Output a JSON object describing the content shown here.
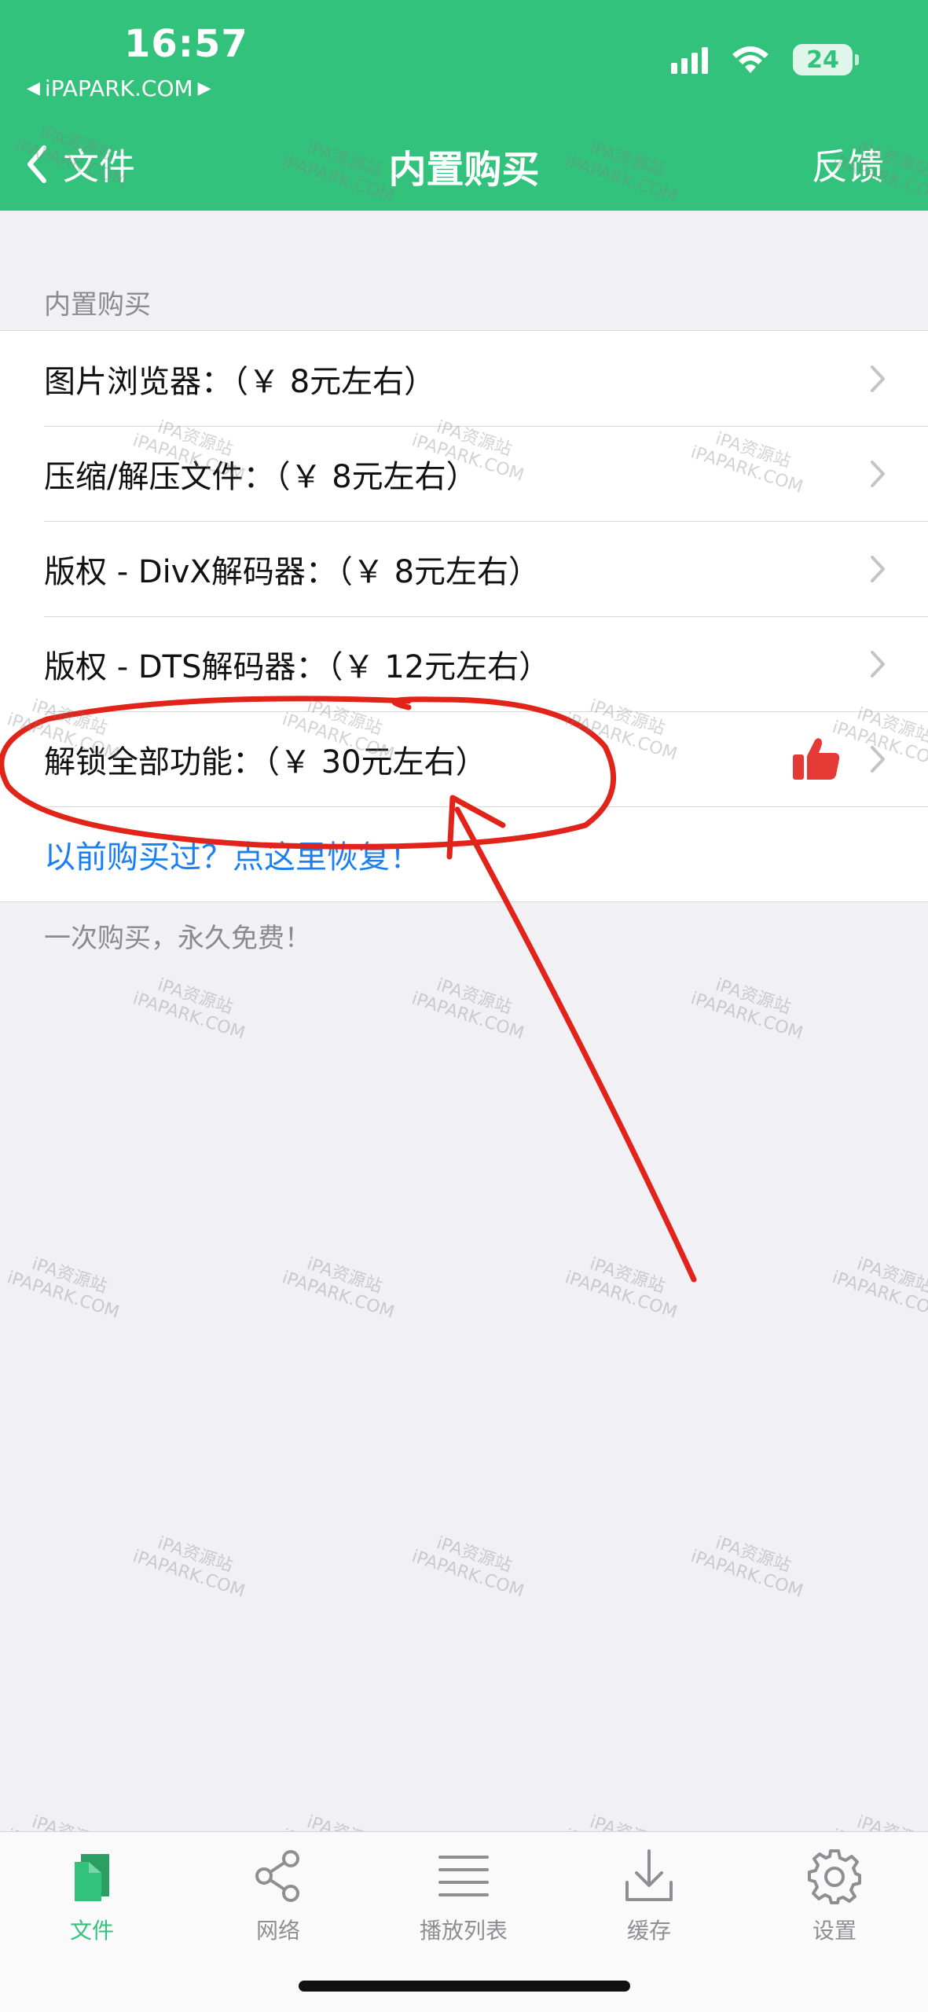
{
  "status_bar": {
    "time": "16:57",
    "back_app": "iPAPARK.COM",
    "battery": "24"
  },
  "nav": {
    "back_label": "文件",
    "title": "内置购买",
    "right_label": "反馈"
  },
  "section": {
    "header": "内置购买",
    "footer": "一次购买，永久免费！",
    "items": [
      {
        "label": "图片浏览器：（￥ 8元左右）"
      },
      {
        "label": "压缩/解压文件：（￥ 8元左右）"
      },
      {
        "label": "版权 - DivX解码器：（￥ 8元左右）"
      },
      {
        "label": "版权 - DTS解码器：（￥ 12元左右）"
      },
      {
        "label": "解锁全部功能：（￥ 30元左右）",
        "icon": "thumbs-up-icon"
      }
    ],
    "restore_link": "以前购买过？点这里恢复！"
  },
  "watermark": {
    "line1": "iPA资源站",
    "line2": "iPAPARK.COM"
  },
  "tabbar": {
    "items": [
      {
        "label": "文件",
        "icon": "file-icon",
        "active": true
      },
      {
        "label": "网络",
        "icon": "share-icon",
        "active": false
      },
      {
        "label": "播放列表",
        "icon": "list-icon",
        "active": false
      },
      {
        "label": "缓存",
        "icon": "download-icon",
        "active": false
      },
      {
        "label": "设置",
        "icon": "gear-icon",
        "active": false
      }
    ]
  },
  "colors": {
    "brand_green": "#33c27c",
    "link_blue": "#1a7ff2",
    "annotation_red": "#e2231a",
    "thumb_red": "#e53935"
  }
}
